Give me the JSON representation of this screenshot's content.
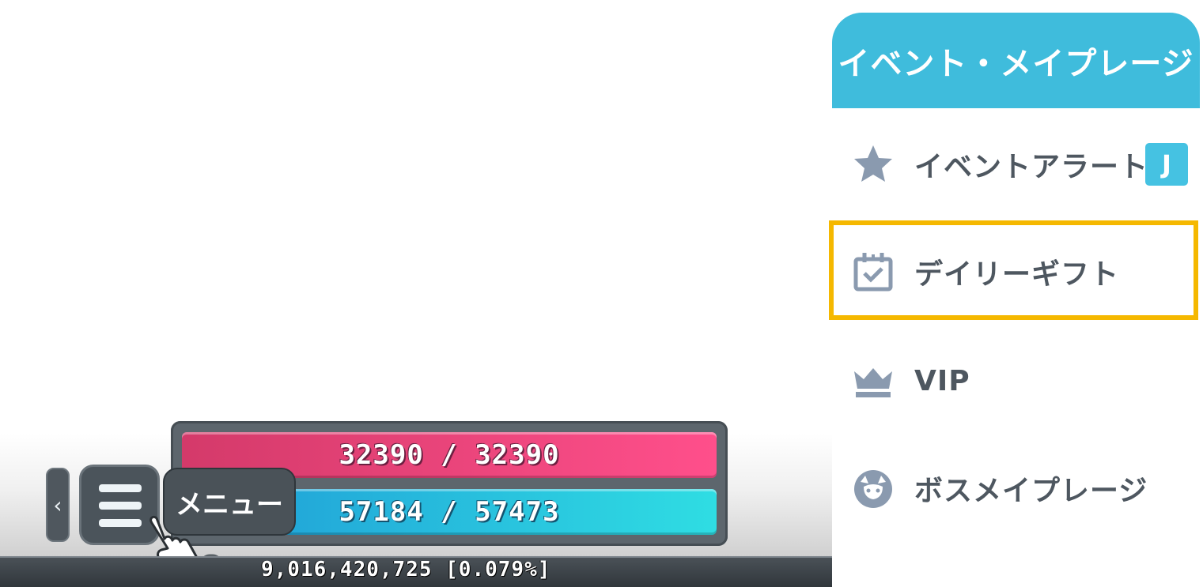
{
  "status_bar": {
    "hp_text": "32390 / 32390",
    "mp_text": "57184 / 57473",
    "exp_text": "9,016,420,725 [0.079%]",
    "collapse_glyph": "‹",
    "menu_tooltip": "メニュー"
  },
  "side_panel": {
    "title": "イベント・メイプレージ",
    "items": [
      {
        "label": "イベントアラート",
        "icon": "star-icon",
        "badge": "J"
      },
      {
        "label": "デイリーギフト",
        "icon": "calendar-check-icon",
        "highlighted": true
      },
      {
        "label": "VIP",
        "icon": "crown-icon"
      },
      {
        "label": "ボスメイプレージ",
        "icon": "boss-face-icon"
      }
    ]
  },
  "colors": {
    "header": "#3fbcdc",
    "highlight": "#f5b800",
    "hp": "#ff4f8b",
    "mp": "#2fdde3",
    "icon": "#8a9aaf"
  }
}
